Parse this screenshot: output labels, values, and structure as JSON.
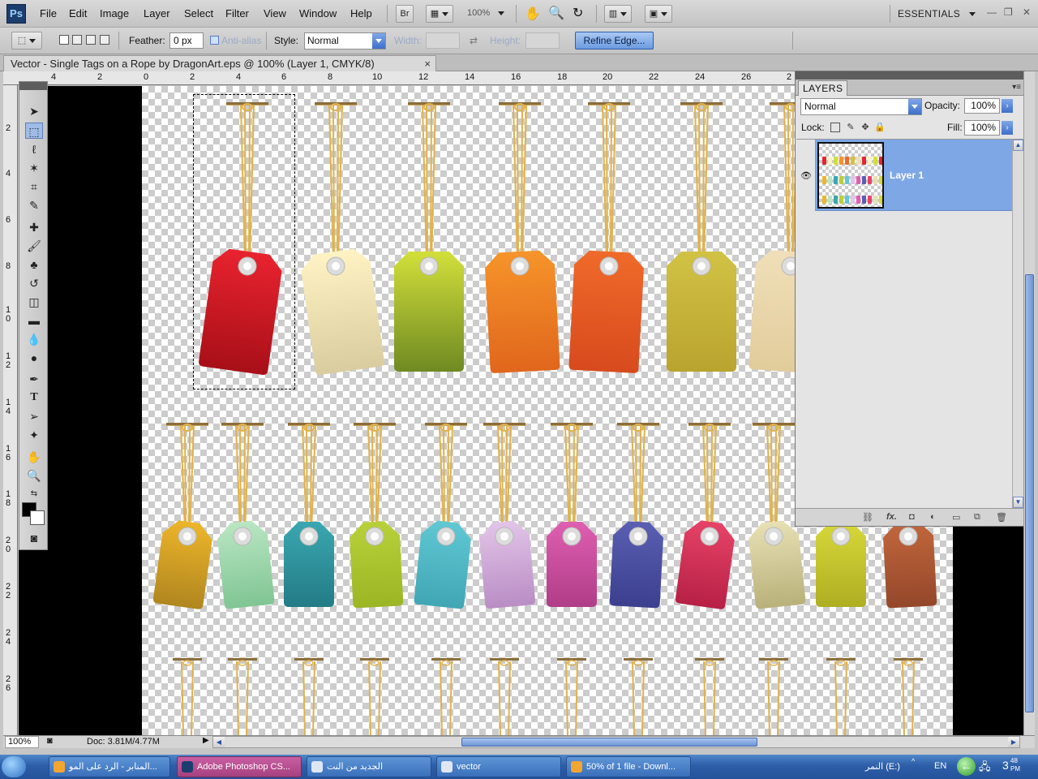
{
  "menubar": {
    "logo": "Ps",
    "items": [
      "File",
      "Edit",
      "Image",
      "Layer",
      "Select",
      "Filter",
      "View",
      "Window",
      "Help"
    ],
    "bridge_btn": "Br",
    "zoom": "100%",
    "workspace": "ESSENTIALS"
  },
  "options": {
    "feather_label": "Feather:",
    "feather_value": "0 px",
    "antialias_label": "Anti-alias",
    "style_label": "Style:",
    "style_value": "Normal",
    "width_label": "Width:",
    "height_label": "Height:",
    "refine_edge": "Refine Edge..."
  },
  "document": {
    "tab_title": "Vector - Single Tags on a Rope by DragonArt.eps @ 100% (Layer 1, CMYK/8)",
    "close": "×"
  },
  "ruler_top": [
    "4",
    "2",
    "0",
    "2",
    "4",
    "6",
    "8",
    "10",
    "12",
    "14",
    "16",
    "18",
    "20",
    "22",
    "24",
    "26",
    "2"
  ],
  "ruler_left": [
    "2",
    "4",
    "6",
    "8",
    "1\n0",
    "1\n2",
    "1\n4",
    "1\n6",
    "1\n8",
    "2\n0",
    "2\n2",
    "2\n4",
    "2\n6"
  ],
  "layers": {
    "tab": "LAYERS",
    "blend_mode": "Normal",
    "opacity_label": "Opacity:",
    "opacity": "100%",
    "lock_label": "Lock:",
    "fill_label": "Fill:",
    "fill": "100%",
    "layer_name": "Layer 1"
  },
  "status": {
    "zoom": "100%",
    "doc": "Doc: 3.81M/4.77M"
  },
  "taskbar": {
    "items": [
      "المنابر - الرد على المو...",
      "Adobe Photoshop CS...",
      "الجديد من النت",
      "vector",
      "50% of 1 file - Downl..."
    ],
    "drive": "النمر (E:)",
    "lang": "EN",
    "clock_hour": "3",
    "clock_min": "48",
    "clock_ampm": "PM"
  },
  "tags_row1": [
    {
      "color_top": "#e8232f",
      "color_bottom": "#a80f18",
      "rot": 8
    },
    {
      "color_top": "#fff3c4",
      "color_bottom": "#d9cd9f",
      "rot": -8
    },
    {
      "color_top": "#d2df3a",
      "color_bottom": "#6f8a22",
      "rot": 0
    },
    {
      "color_top": "#f6942a",
      "color_bottom": "#e0661c",
      "rot": -3
    },
    {
      "color_top": "#ef6a2a",
      "color_bottom": "#d84a1d",
      "rot": 3
    },
    {
      "color_top": "#d1c244",
      "color_bottom": "#b9a42f",
      "rot": 0
    },
    {
      "color_top": "#f0dfb9",
      "color_bottom": "#e1cc9b",
      "rot": 4
    }
  ],
  "tags_row2": [
    {
      "color_top": "#edb52a",
      "color_bottom": "#b0861f",
      "rot": 8
    },
    {
      "color_top": "#b9e6c2",
      "color_bottom": "#80c594",
      "rot": -6
    },
    {
      "color_top": "#3aa7b0",
      "color_bottom": "#237b86",
      "rot": 0
    },
    {
      "color_top": "#b8d13a",
      "color_bottom": "#9bb624",
      "rot": -3
    },
    {
      "color_top": "#5fc8d3",
      "color_bottom": "#41a6b4",
      "rot": 6
    },
    {
      "color_top": "#e2c4e8",
      "color_bottom": "#b98dc4",
      "rot": -5
    },
    {
      "color_top": "#df5fb0",
      "color_bottom": "#b03d88",
      "rot": 0
    },
    {
      "color_top": "#5a5fb2",
      "color_bottom": "#3c3f8e",
      "rot": 3
    },
    {
      "color_top": "#e64367",
      "color_bottom": "#b72045",
      "rot": 8
    },
    {
      "color_top": "#e7e0b4",
      "color_bottom": "#b9b17a",
      "rot": -6
    },
    {
      "color_top": "#d7d83a",
      "color_bottom": "#aeae22",
      "rot": 0
    },
    {
      "color_top": "#c2673d",
      "color_bottom": "#94472a",
      "rot": -3
    }
  ]
}
